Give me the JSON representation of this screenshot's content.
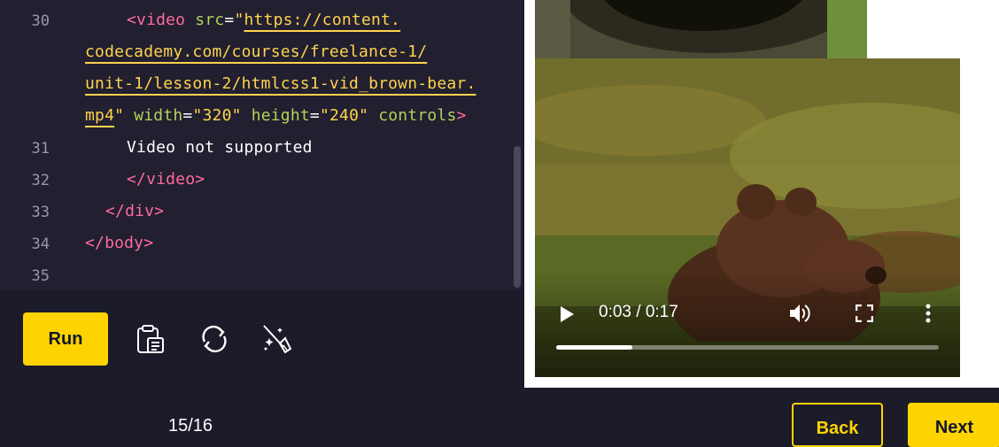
{
  "editor": {
    "lines": [
      {
        "number": "30"
      },
      {
        "number": "31"
      },
      {
        "number": "32"
      },
      {
        "number": "33"
      },
      {
        "number": "34"
      },
      {
        "number": "35"
      }
    ],
    "video_open_tag": "<video",
    "src_attr": "src",
    "eq": "=",
    "quote": "\"",
    "url_part1": "https://content.",
    "url_part2": "codecademy.com/courses/freelance-1/",
    "url_part3": "unit-1/lesson-2/htmlcss1-vid_brown-bear.",
    "url_part4": "mp4",
    "width_attr": "width",
    "width_val": "\"320\"",
    "height_attr": "height",
    "height_val": "\"240\"",
    "controls_attr": "controls",
    "gt": ">",
    "fallback_text": "Video not supported",
    "video_close": "</video>",
    "div_close": "</div>",
    "body_close": "</body>"
  },
  "toolbar": {
    "run_label": "Run",
    "icons": [
      "clipboard-icon",
      "refresh-icon",
      "magic-wand-icon"
    ]
  },
  "video": {
    "time": "0:03 / 0:17",
    "progress": 0.2,
    "icons": [
      "play-icon",
      "volume-icon",
      "fullscreen-icon",
      "more-icon"
    ]
  },
  "footer": {
    "page_count": "15/16",
    "back_label": "Back",
    "next_label": "Next"
  },
  "colors": {
    "accent": "#ffd300",
    "tag": "#ff6b9d",
    "attr": "#b3d35a",
    "string": "#ffd34e"
  }
}
